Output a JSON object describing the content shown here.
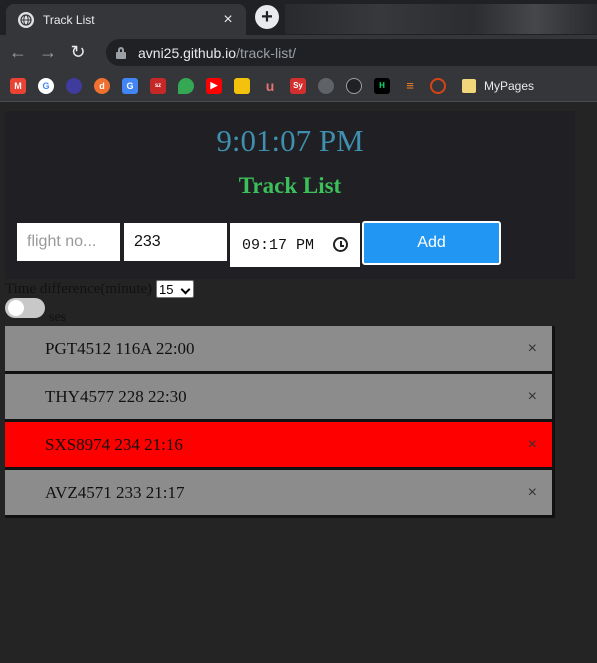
{
  "browser": {
    "tab_title": "Track List",
    "tab_close": "×",
    "new_tab": "+",
    "url_host": "avni25.github.io",
    "url_path": "/track-list/",
    "bookmark_folder": "MyPages"
  },
  "app": {
    "clock": "9:01:07 PM",
    "title": "Track List",
    "flight_placeholder": "flight no...",
    "number_value": "233",
    "time_value": "09:17 PM",
    "add_label": "Add",
    "diff_label": "Time difference(minute)",
    "diff_value": "15",
    "toggle_label": "ses",
    "tracks": [
      {
        "text": "PGT4512 116A 22:00",
        "color": "#8c8c8c"
      },
      {
        "text": "THY4577 228 22:30",
        "color": "#8c8c8c"
      },
      {
        "text": "SXS8974 234 21:16",
        "color": "#ff0000"
      },
      {
        "text": "AVZ4571 233 21:17",
        "color": "#8c8c8c"
      }
    ],
    "close_glyph": "×"
  },
  "colors": {
    "clock": "#3f8fae",
    "title": "#3cc05a",
    "add_button": "#2196f3",
    "highlight_row": "#ff0000"
  }
}
